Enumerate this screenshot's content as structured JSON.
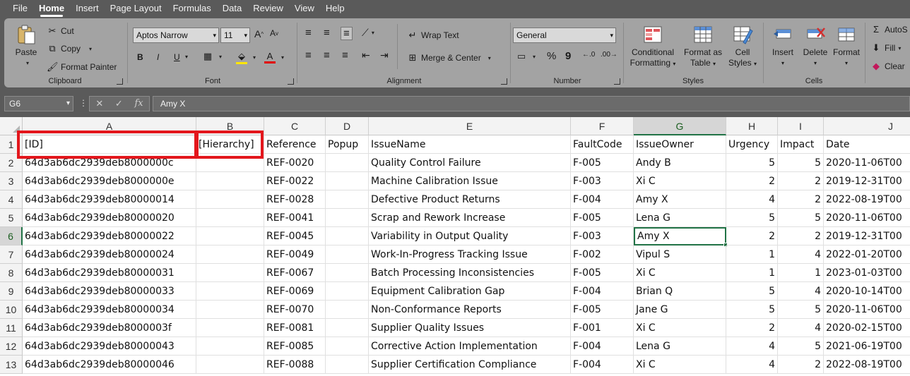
{
  "menu": [
    "File",
    "Home",
    "Insert",
    "Page Layout",
    "Formulas",
    "Data",
    "Review",
    "View",
    "Help"
  ],
  "ribbon": {
    "clipboard": {
      "label": "Clipboard",
      "paste": "Paste",
      "cut": "Cut",
      "copy": "Copy",
      "format_painter": "Format Painter"
    },
    "font": {
      "label": "Font",
      "font_name": "Aptos Narrow",
      "font_size": "11",
      "bold": "B",
      "italic": "I",
      "underline": "U"
    },
    "alignment": {
      "label": "Alignment",
      "wrap_text": "Wrap Text",
      "merge_center": "Merge & Center"
    },
    "number": {
      "label": "Number",
      "format": "General",
      "percent": "%",
      "comma": "9"
    },
    "styles": {
      "label": "Styles",
      "conditional": [
        "Conditional",
        "Formatting"
      ],
      "format_table": [
        "Format as",
        "Table"
      ],
      "cell_styles": [
        "Cell",
        "Styles"
      ]
    },
    "cells": {
      "label": "Cells",
      "insert": "Insert",
      "delete": "Delete",
      "format": "Format"
    },
    "editing": {
      "autosum": "AutoS",
      "fill": "Fill",
      "clear": "Clear"
    }
  },
  "formula_bar": {
    "name_box": "G6",
    "fx": "fx",
    "value": "Amy X"
  },
  "columns": [
    "A",
    "B",
    "C",
    "D",
    "E",
    "F",
    "G",
    "H",
    "I",
    "J"
  ],
  "rows": [
    [
      "[ID]",
      "[Hierarchy]",
      "Reference",
      "Popup",
      "IssueName",
      "FaultCode",
      "IssueOwner",
      "Urgency",
      "Impact",
      "Date"
    ],
    [
      "64d3ab6dc2939deb8000000c",
      "",
      "REF-0020",
      "",
      "Quality Control Failure",
      "F-005",
      "Andy B",
      "5",
      "5",
      "2020-11-06T00"
    ],
    [
      "64d3ab6dc2939deb8000000e",
      "",
      "REF-0022",
      "",
      "Machine Calibration Issue",
      "F-003",
      "Xi C",
      "2",
      "2",
      "2019-12-31T00"
    ],
    [
      "64d3ab6dc2939deb80000014",
      "",
      "REF-0028",
      "",
      "Defective Product Returns",
      "F-004",
      "Amy X",
      "4",
      "2",
      "2022-08-19T00"
    ],
    [
      "64d3ab6dc2939deb80000020",
      "",
      "REF-0041",
      "",
      "Scrap and Rework Increase",
      "F-005",
      "Lena G",
      "5",
      "5",
      "2020-11-06T00"
    ],
    [
      "64d3ab6dc2939deb80000022",
      "",
      "REF-0045",
      "",
      "Variability in Output Quality",
      "F-003",
      "Amy X",
      "2",
      "2",
      "2019-12-31T00"
    ],
    [
      "64d3ab6dc2939deb80000024",
      "",
      "REF-0049",
      "",
      "Work-In-Progress Tracking Issue",
      "F-002",
      "Vipul S",
      "1",
      "4",
      "2022-01-20T00"
    ],
    [
      "64d3ab6dc2939deb80000031",
      "",
      "REF-0067",
      "",
      "Batch Processing Inconsistencies",
      "F-005",
      "Xi C",
      "1",
      "1",
      "2023-01-03T00"
    ],
    [
      "64d3ab6dc2939deb80000033",
      "",
      "REF-0069",
      "",
      "Equipment Calibration Gap",
      "F-004",
      "Brian Q",
      "5",
      "4",
      "2020-10-14T00"
    ],
    [
      "64d3ab6dc2939deb80000034",
      "",
      "REF-0070",
      "",
      "Non-Conformance Reports",
      "F-005",
      "Jane G",
      "5",
      "5",
      "2020-11-06T00"
    ],
    [
      "64d3ab6dc2939deb8000003f",
      "",
      "REF-0081",
      "",
      "Supplier Quality Issues",
      "F-001",
      "Xi C",
      "2",
      "4",
      "2020-02-15T00"
    ],
    [
      "64d3ab6dc2939deb80000043",
      "",
      "REF-0085",
      "",
      "Corrective Action Implementation",
      "F-004",
      "Lena G",
      "4",
      "5",
      "2021-06-19T00"
    ],
    [
      "64d3ab6dc2939deb80000046",
      "",
      "REF-0088",
      "",
      "Supplier Certification Compliance",
      "F-004",
      "Xi C",
      "4",
      "2",
      "2022-08-19T00"
    ]
  ],
  "row_numbers": [
    "1",
    "2",
    "3",
    "4",
    "5",
    "6",
    "7",
    "8",
    "9",
    "10",
    "11",
    "12",
    "13"
  ],
  "active_cell": {
    "col": "G",
    "row": "6"
  },
  "colors": {
    "accent": "#217346",
    "highlight": "#e3161c"
  }
}
